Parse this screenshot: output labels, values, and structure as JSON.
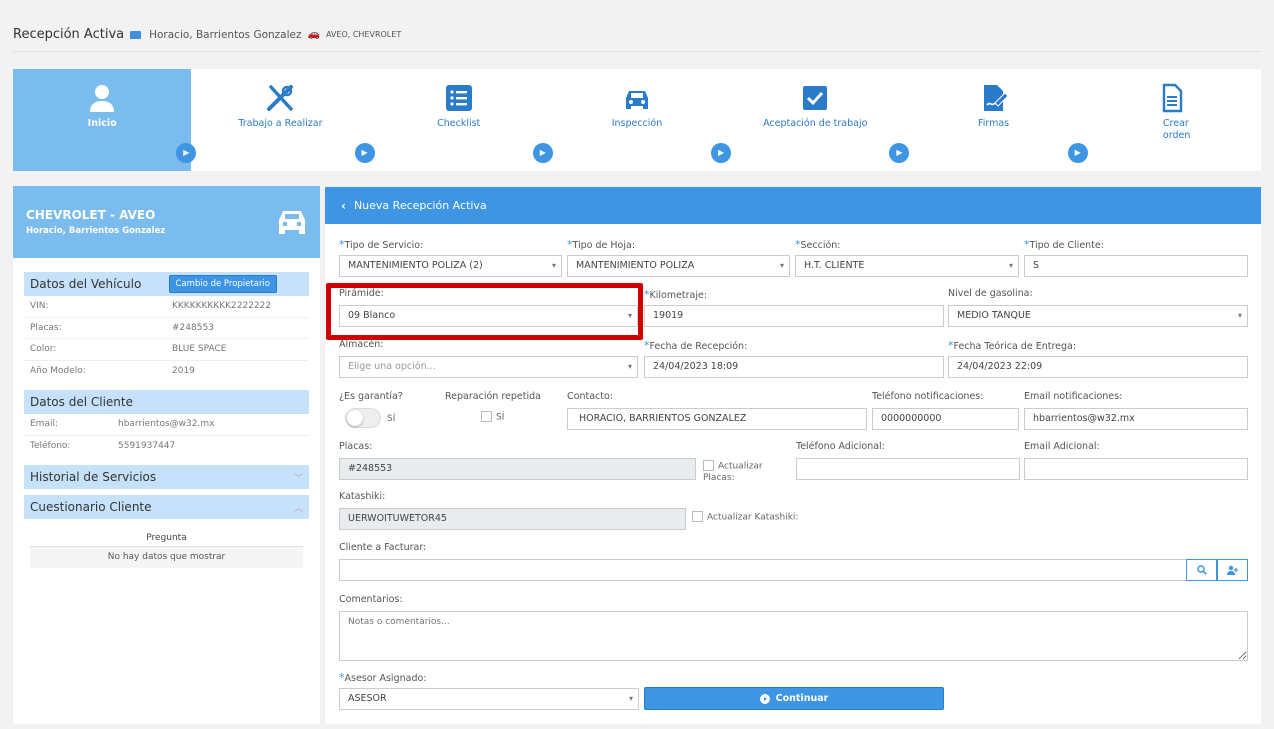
{
  "header": {
    "title": "Recepción Activa",
    "client": "Horacio, Barrientos Gonzalez",
    "vehicle": "AVEO, CHEVROLET"
  },
  "steps": [
    {
      "label": "Inicio",
      "icon": "user-icon",
      "active": true
    },
    {
      "label": "Trabajo a Realizar",
      "icon": "tools-icon"
    },
    {
      "label": "Checklist",
      "icon": "list-icon"
    },
    {
      "label": "Inspección",
      "icon": "car-icon"
    },
    {
      "label": "Aceptación de trabajo",
      "icon": "checkbox-icon"
    },
    {
      "label": "Firmas",
      "icon": "signature-icon"
    },
    {
      "label": "Crear orden",
      "icon": "document-icon"
    }
  ],
  "sidebar": {
    "vehicle_title": "CHEVROLET - AVEO",
    "client_name": "Horacio, Barrientos Gonzalez",
    "vehicle_section": "Datos del Vehículo",
    "change_owner_label": "Cambio de Propietario",
    "vehicle_rows": [
      {
        "k": "VIN:",
        "v": "KKKKKKKKKK2222222"
      },
      {
        "k": "Placas:",
        "v": "#248553"
      },
      {
        "k": "Color:",
        "v": "BLUE SPACE"
      },
      {
        "k": "Año Modelo:",
        "v": "2019"
      }
    ],
    "client_section": "Datos del Cliente",
    "client_rows": [
      {
        "k": "Email:",
        "v": "hbarrientos@w32.mx"
      },
      {
        "k": "Teléfono:",
        "v": "5591937447"
      }
    ],
    "history_section": "Historial de Servicios",
    "quiz_section": "Cuestionario Cliente",
    "quiz_header": "Pregunta",
    "quiz_empty": "No hay datos que mostrar"
  },
  "form": {
    "panel_title": "Nueva Recepción Activa",
    "tipo_servicio": {
      "label": "Tipo de Servicio:",
      "value": "MANTENIMIENTO POLIZA (2)"
    },
    "tipo_hoja": {
      "label": "Tipo de Hoja:",
      "value": "MANTENIMIENTO POLIZA"
    },
    "seccion": {
      "label": "Sección:",
      "value": "H.T. CLIENTE"
    },
    "tipo_cliente": {
      "label": "Tipo de Cliente:",
      "value": "S"
    },
    "piramide": {
      "label": "Pirámide:",
      "value": "09 Blanco"
    },
    "kilometraje": {
      "label": "Kilometraje:",
      "value": "19019"
    },
    "gasolina": {
      "label": "Nivel de gasolina:",
      "value": "MEDIO TANQUE"
    },
    "almacen": {
      "label": "Almacén:",
      "placeholder": "Elige una opción..."
    },
    "fecha_recepcion": {
      "label": "Fecha de Recepción:",
      "value": "24/04/2023 18:09"
    },
    "fecha_entrega": {
      "label": "Fecha Teórica de Entrega:",
      "value": "24/04/2023 22:09"
    },
    "garantia": {
      "label": "¿Es garantía?",
      "toggle_label": "SÍ"
    },
    "reparacion": {
      "label": "Reparación repetida",
      "check_label": "SÍ"
    },
    "contacto": {
      "label": "Contacto:",
      "value": "HORACIO, BARRIENTOS GONZALEZ"
    },
    "tel_notif": {
      "label": "Teléfono notificaciones:",
      "value": "0000000000"
    },
    "email_notif": {
      "label": "Email notificaciones:",
      "value": "hbarrientos@w32.mx"
    },
    "placas": {
      "label": "Placas:",
      "value": "#248553",
      "check_label": "Actualizar Placas:"
    },
    "tel_adicional": {
      "label": "Teléfono Adicional:"
    },
    "email_adicional": {
      "label": "Email Adicional:"
    },
    "katashiki": {
      "label": "Katashiki:",
      "value": "UERWOITUWETOR45",
      "check_label": "Actualizar Katashiki:"
    },
    "cliente_facturar": {
      "label": "Cliente a Facturar:"
    },
    "comentarios": {
      "label": "Comentarios:",
      "placeholder": "Notas o comentarios..."
    },
    "asesor": {
      "label": "Asesor Asignado:",
      "value": "ASESOR"
    },
    "continue_label": "Continuar"
  },
  "colors": {
    "accent": "#3d95e3",
    "active_step": "#7bbcee",
    "highlight": "#d10000"
  }
}
